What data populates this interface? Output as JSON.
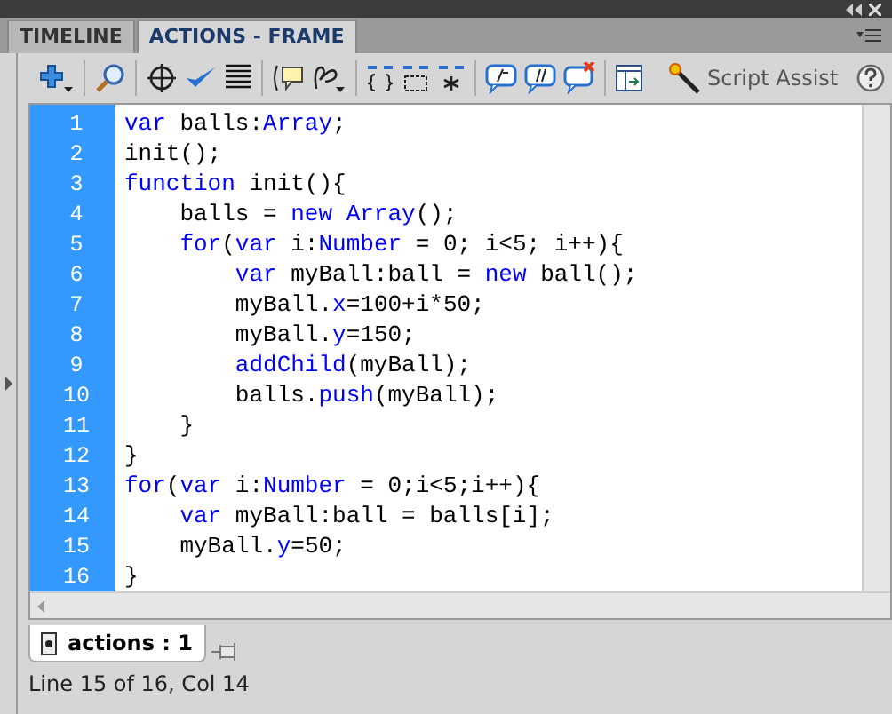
{
  "tabs": [
    {
      "label": "TIMELINE",
      "selected": false
    },
    {
      "label": "ACTIONS - FRAME",
      "selected": true
    }
  ],
  "toolbar": {
    "script_assist": "Script Assist"
  },
  "code": [
    {
      "number": "1",
      "tokens": [
        {
          "text": "var",
          "kind": "kw"
        },
        {
          "text": " balls:",
          "kind": "plain"
        },
        {
          "text": "Array",
          "kind": "kw"
        },
        {
          "text": ";",
          "kind": "plain"
        }
      ]
    },
    {
      "number": "2",
      "tokens": [
        {
          "text": "init();",
          "kind": "plain"
        }
      ]
    },
    {
      "number": "3",
      "tokens": [
        {
          "text": "function",
          "kind": "kw"
        },
        {
          "text": " init(){",
          "kind": "plain"
        }
      ]
    },
    {
      "number": "4",
      "tokens": [
        {
          "text": "    balls = ",
          "kind": "plain"
        },
        {
          "text": "new",
          "kind": "kw"
        },
        {
          "text": " Array",
          "kind": "kw"
        },
        {
          "text": "();",
          "kind": "plain"
        }
      ]
    },
    {
      "number": "5",
      "tokens": [
        {
          "text": "    for",
          "kind": "kw"
        },
        {
          "text": "(",
          "kind": "plain"
        },
        {
          "text": "var",
          "kind": "kw"
        },
        {
          "text": " i:",
          "kind": "plain"
        },
        {
          "text": "Number",
          "kind": "kw"
        },
        {
          "text": " = 0; i<5; i++){",
          "kind": "plain"
        }
      ]
    },
    {
      "number": "6",
      "tokens": [
        {
          "text": "        var",
          "kind": "kw"
        },
        {
          "text": " myBall:ball = ",
          "kind": "plain"
        },
        {
          "text": "new",
          "kind": "kw"
        },
        {
          "text": " ball();",
          "kind": "plain"
        }
      ]
    },
    {
      "number": "7",
      "tokens": [
        {
          "text": "        myBall.",
          "kind": "plain"
        },
        {
          "text": "x",
          "kind": "kw"
        },
        {
          "text": "=100+i*50;",
          "kind": "plain"
        }
      ]
    },
    {
      "number": "8",
      "tokens": [
        {
          "text": "        myBall.",
          "kind": "plain"
        },
        {
          "text": "y",
          "kind": "kw"
        },
        {
          "text": "=150;",
          "kind": "plain"
        }
      ]
    },
    {
      "number": "9",
      "tokens": [
        {
          "text": "        addChild",
          "kind": "kw"
        },
        {
          "text": "(myBall);",
          "kind": "plain"
        }
      ]
    },
    {
      "number": "10",
      "tokens": [
        {
          "text": "        balls.",
          "kind": "plain"
        },
        {
          "text": "push",
          "kind": "kw"
        },
        {
          "text": "(myBall);",
          "kind": "plain"
        }
      ]
    },
    {
      "number": "11",
      "tokens": [
        {
          "text": "    }",
          "kind": "plain"
        }
      ]
    },
    {
      "number": "12",
      "tokens": [
        {
          "text": "}",
          "kind": "plain"
        }
      ]
    },
    {
      "number": "13",
      "tokens": [
        {
          "text": "for",
          "kind": "kw"
        },
        {
          "text": "(",
          "kind": "plain"
        },
        {
          "text": "var",
          "kind": "kw"
        },
        {
          "text": " i:",
          "kind": "plain"
        },
        {
          "text": "Number",
          "kind": "kw"
        },
        {
          "text": " = 0;i<5;i++){",
          "kind": "plain"
        }
      ]
    },
    {
      "number": "14",
      "tokens": [
        {
          "text": "    var",
          "kind": "kw"
        },
        {
          "text": " myBall:ball = balls[i];",
          "kind": "plain"
        }
      ]
    },
    {
      "number": "15",
      "tokens": [
        {
          "text": "    myBall.",
          "kind": "plain"
        },
        {
          "text": "y",
          "kind": "kw"
        },
        {
          "text": "=50;",
          "kind": "plain"
        }
      ]
    },
    {
      "number": "16",
      "tokens": [
        {
          "text": "}",
          "kind": "plain"
        }
      ]
    }
  ],
  "script_tab": {
    "label": "actions : 1"
  },
  "status_bar": "Line 15 of 16, Col 14"
}
